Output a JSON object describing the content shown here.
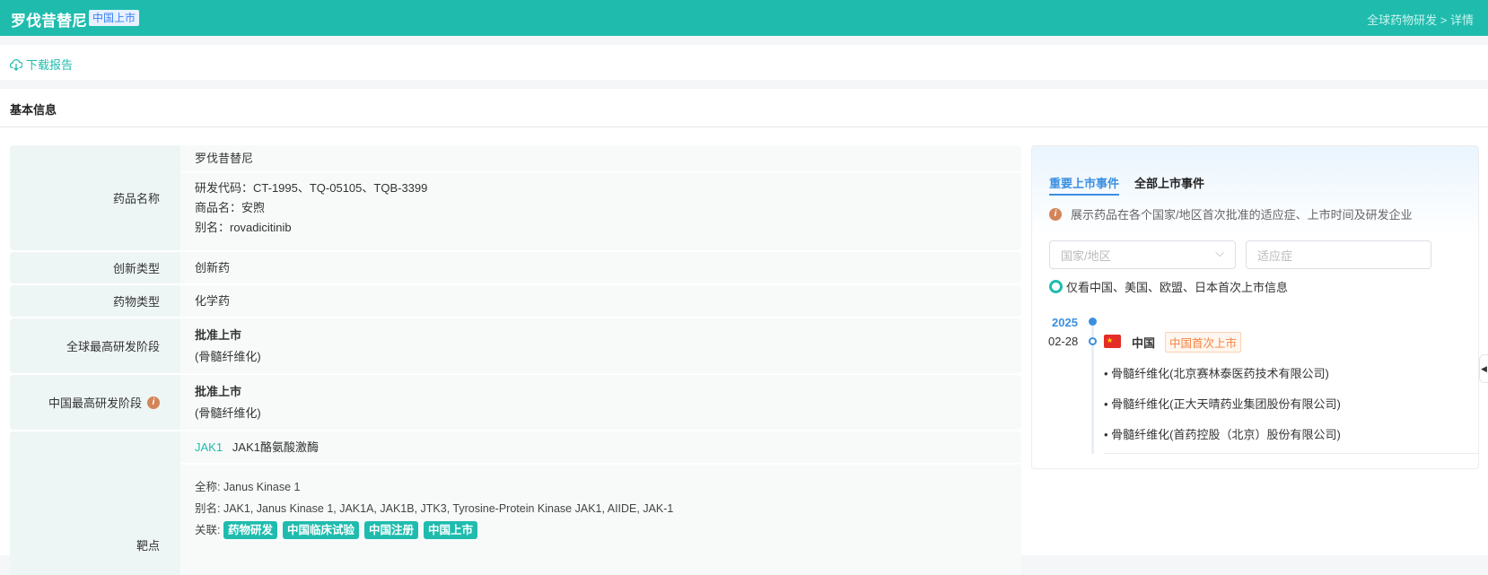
{
  "header": {
    "title": "罗伐昔替尼",
    "status_tag": "中国上市",
    "breadcrumb": "全球药物研发 > 详情"
  },
  "toolbar": {
    "download_label": "下载报告"
  },
  "section": {
    "title": "基本信息"
  },
  "table": {
    "drug_name": {
      "label": "药品名称",
      "name": "罗伐昔替尼",
      "codes": "研发代码：CT-1995、TQ-05105、TQB-3399",
      "trade_name": "商品名：安煦",
      "alias": "别名：rovadicitinib"
    },
    "innovation": {
      "label": "创新类型",
      "value": "创新药"
    },
    "drug_type": {
      "label": "药物类型",
      "value": "化学药"
    },
    "global_stage": {
      "label": "全球最高研发阶段",
      "value": "批准上市",
      "indication": "(骨髓纤维化)"
    },
    "china_stage": {
      "label": "中国最高研发阶段",
      "value": "批准上市",
      "indication": "(骨髓纤维化)"
    },
    "target": {
      "label": "靶点",
      "code": "JAK1",
      "name": "JAK1酪氨酸激酶",
      "full_name_label": "全称:",
      "full_name": "Janus Kinase 1",
      "alias_label": "别名:",
      "alias": "JAK1, Janus Kinase 1, JAK1A, JAK1B, JTK3, Tyrosine-Protein Kinase JAK1, AIIDE, JAK-1",
      "related_label": "关联:",
      "related": [
        "药物研发",
        "中国临床试验",
        "中国注册",
        "中国上市"
      ]
    }
  },
  "panel": {
    "tabs": [
      "重要上市事件",
      "全部上市事件"
    ],
    "info": "展示药品在各个国家/地区首次批准的适应症、上市时间及研发企业",
    "country_placeholder": "国家/地区",
    "indication_placeholder": "适应症",
    "radio_label": "仅看中国、美国、欧盟、日本首次上市信息",
    "timeline": {
      "year": "2025",
      "date": "02-28",
      "country": "中国",
      "badge": "中国首次上市",
      "items": [
        "骨髓纤维化(北京赛林泰医药技术有限公司)",
        "骨髓纤维化(正大天晴药业集团股份有限公司)",
        "骨髓纤维化(首药控股（北京）股份有限公司)"
      ]
    }
  },
  "colors": {
    "brand": "#1fbcae",
    "accent": "#3b8fe0",
    "badge": "#f5813f"
  }
}
